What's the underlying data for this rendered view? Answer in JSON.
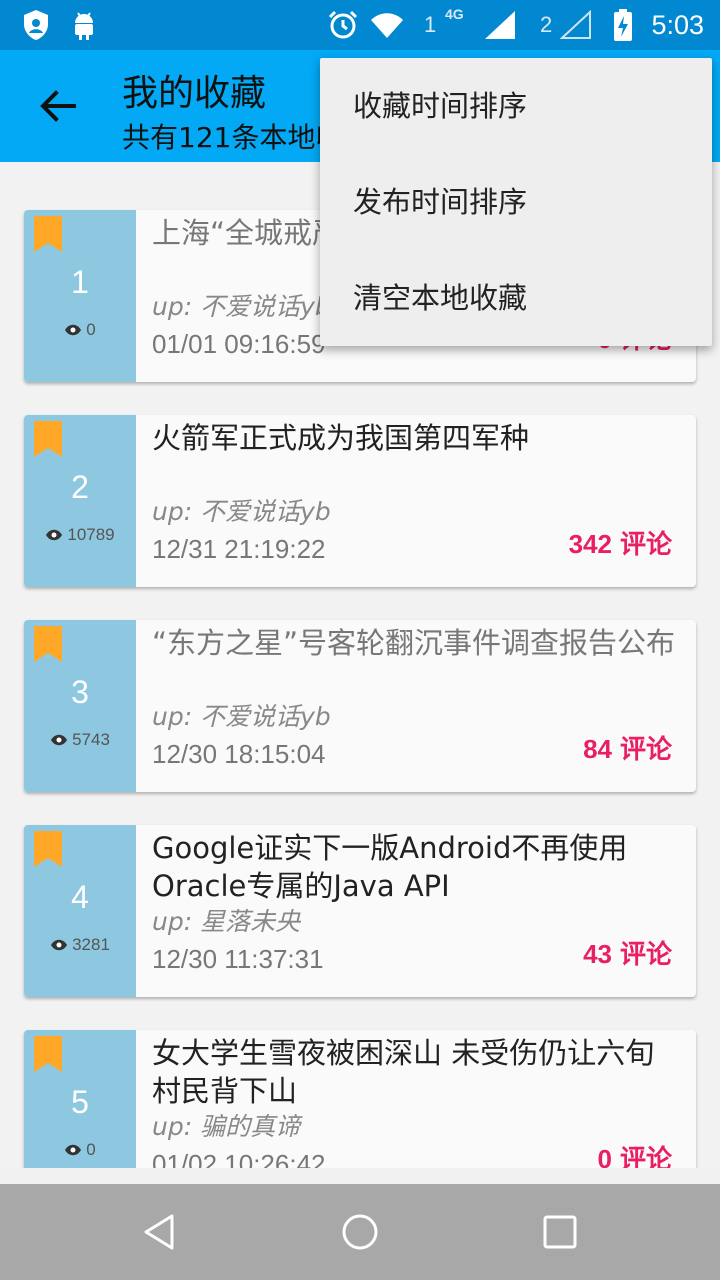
{
  "status_bar": {
    "time": "5:03",
    "sim1": "1",
    "sim2": "2",
    "network": "4G",
    "icons": [
      "shield-icon",
      "android-icon",
      "alarm-icon",
      "wifi-icon",
      "signal-icon",
      "battery-charging-icon"
    ]
  },
  "toolbar": {
    "title": "我的收藏",
    "subtitle": "共有121条本地收藏"
  },
  "menu": {
    "items": [
      "收藏时间排序",
      "发布时间排序",
      "清空本地收藏"
    ]
  },
  "cards": [
    {
      "index": "1",
      "views": "0",
      "headline": "上海“全城戒严”？辟谣：外滩区域无活动",
      "up": "up: 不爱说话yb",
      "date": "01/01 09:16:59",
      "comments": "0",
      "comments_label": "评论",
      "read": true
    },
    {
      "index": "2",
      "views": "10789",
      "headline": "火箭军正式成为我国第四军种",
      "up": "up: 不爱说话yb",
      "date": "12/31 21:19:22",
      "comments": "342",
      "comments_label": "评论",
      "read": false
    },
    {
      "index": "3",
      "views": "5743",
      "headline": "“东方之星”号客轮翻沉事件调查报告公布",
      "up": "up: 不爱说话yb",
      "date": "12/30 18:15:04",
      "comments": "84",
      "comments_label": "评论",
      "read": true
    },
    {
      "index": "4",
      "views": "3281",
      "headline": "Google证实下一版Android不再使用Oracle专属的Java API",
      "up": "up: 星落未央",
      "date": "12/30 11:37:31",
      "comments": "43",
      "comments_label": "评论",
      "read": false
    },
    {
      "index": "5",
      "views": "0",
      "headline": "女大学生雪夜被困深山 未受伤仍让六旬村民背下山",
      "up": "up: 骗的真谛",
      "date": "01/02 10:26:42",
      "comments": "0",
      "comments_label": "评论",
      "read": false
    }
  ],
  "colors": {
    "status_bar": "#0288d1",
    "toolbar": "#03a9f4",
    "card_left": "#8ec8e0",
    "bookmark": "#ffa726",
    "comments": "#e91e63",
    "navbar": "#a8a8a8"
  }
}
